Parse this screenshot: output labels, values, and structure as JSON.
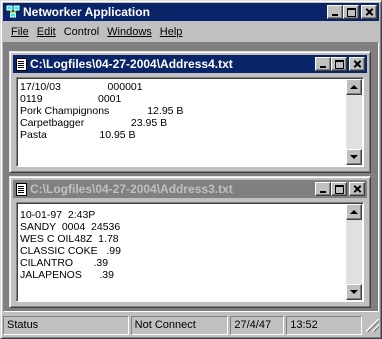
{
  "app": {
    "title": "Networker Application"
  },
  "menu": {
    "file": "File",
    "edit": "Edit",
    "control": "Control",
    "windows": "Windows",
    "help": "Help"
  },
  "windows": [
    {
      "title": "C:\\Logfiles\\04-27-2004\\Address4.txt",
      "active": true,
      "lines": [
        "17/10/03                000001",
        "0119                   0001",
        "Pork Champignons             12.95 B",
        "Carpetbagger                23.95 B",
        "Pasta                  10.95 B"
      ]
    },
    {
      "title": "C:\\Logfiles\\04-27-2004\\Address3.txt",
      "active": false,
      "lines": [
        "10-01-97  2:43P",
        "SANDY  0004  24536",
        "WES C OIL48Z  1.78",
        "CLASSIC COKE   .99",
        "CILANTRO       .39",
        "JALAPENOS      .39"
      ]
    }
  ],
  "status": {
    "label": "Status",
    "connection": "Not Connect",
    "date": "27/4/47",
    "time": "13:52"
  },
  "icons": {
    "app": "network-computers-icon",
    "document": "text-document-icon"
  },
  "colors": {
    "active_title": "#0a246a",
    "inactive_title": "#808080",
    "face": "#c0c0c0"
  }
}
